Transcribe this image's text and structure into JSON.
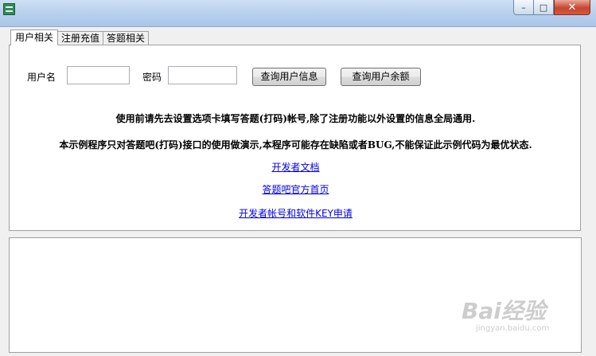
{
  "window": {
    "title": "",
    "minimize_glyph": "–",
    "maximize_glyph": "□",
    "close_glyph": "✕",
    "icon": "app-icon"
  },
  "tabs": [
    {
      "label": "用户相关",
      "active": true
    },
    {
      "label": "注册充值",
      "active": false
    },
    {
      "label": "答题相关",
      "active": false
    }
  ],
  "form": {
    "username_label": "用户名",
    "username_value": "",
    "password_label": "密码",
    "password_value": "",
    "query_info_button": "查询用户信息",
    "query_balance_button": "查询用户余额"
  },
  "notices": [
    "使用前请先去设置选项卡填写答题(打码)帐号,除了注册功能以外设置的信息全局通用.",
    "本示例程序只对答题吧(打码)接口的使用做演示,本程序可能存在缺陷或者BUG,不能保证此示例代码为最优状态."
  ],
  "links": [
    "开发者文档",
    "答题吧官方首页",
    "开发者帐号和软件KEY申请"
  ],
  "output": {
    "text": ""
  },
  "watermark": {
    "brand": "Bai经验",
    "url": "jingyan.baidu.com"
  }
}
